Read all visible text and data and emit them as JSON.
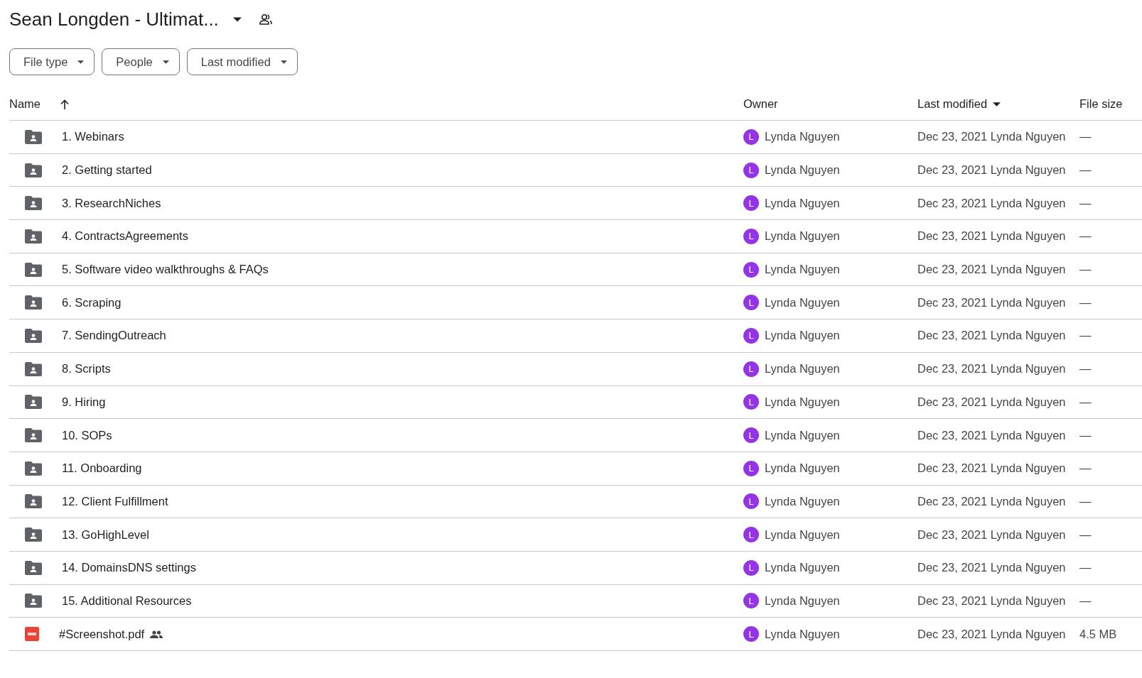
{
  "title": "Sean Longden - Ultimat...",
  "filters": [
    "File type",
    "People",
    "Last modified"
  ],
  "columns": {
    "name": "Name",
    "owner": "Owner",
    "modified": "Last modified",
    "size": "File size"
  },
  "rows": [
    {
      "kind": "folder",
      "name": "1.  Webinars",
      "shared": false,
      "avatar": "L",
      "owner": "Lynda Nguyen",
      "modified": "Dec 23, 2021 Lynda Nguyen",
      "size": "—"
    },
    {
      "kind": "folder",
      "name": "2.  Getting started",
      "shared": false,
      "avatar": "L",
      "owner": "Lynda Nguyen",
      "modified": "Dec 23, 2021 Lynda Nguyen",
      "size": "—"
    },
    {
      "kind": "folder",
      "name": "3. ResearchNiches",
      "shared": false,
      "avatar": "L",
      "owner": "Lynda Nguyen",
      "modified": "Dec 23, 2021 Lynda Nguyen",
      "size": "—"
    },
    {
      "kind": "folder",
      "name": "4. ContractsAgreements",
      "shared": false,
      "avatar": "L",
      "owner": "Lynda Nguyen",
      "modified": "Dec 23, 2021 Lynda Nguyen",
      "size": "—"
    },
    {
      "kind": "folder",
      "name": "5. Software video walkthroughs & FAQs",
      "shared": false,
      "avatar": "L",
      "owner": "Lynda Nguyen",
      "modified": "Dec 23, 2021 Lynda Nguyen",
      "size": "—"
    },
    {
      "kind": "folder",
      "name": "6. Scraping",
      "shared": false,
      "avatar": "L",
      "owner": "Lynda Nguyen",
      "modified": "Dec 23, 2021 Lynda Nguyen",
      "size": "—"
    },
    {
      "kind": "folder",
      "name": "7. SendingOutreach",
      "shared": false,
      "avatar": "L",
      "owner": "Lynda Nguyen",
      "modified": "Dec 23, 2021 Lynda Nguyen",
      "size": "—"
    },
    {
      "kind": "folder",
      "name": "8. Scripts",
      "shared": false,
      "avatar": "L",
      "owner": "Lynda Nguyen",
      "modified": "Dec 23, 2021 Lynda Nguyen",
      "size": "—"
    },
    {
      "kind": "folder",
      "name": "9. Hiring",
      "shared": false,
      "avatar": "L",
      "owner": "Lynda Nguyen",
      "modified": "Dec 23, 2021 Lynda Nguyen",
      "size": "—"
    },
    {
      "kind": "folder",
      "name": "10. SOPs",
      "shared": false,
      "avatar": "L",
      "owner": "Lynda Nguyen",
      "modified": "Dec 23, 2021 Lynda Nguyen",
      "size": "—"
    },
    {
      "kind": "folder",
      "name": "11. Onboarding",
      "shared": false,
      "avatar": "L",
      "owner": "Lynda Nguyen",
      "modified": "Dec 23, 2021 Lynda Nguyen",
      "size": "—"
    },
    {
      "kind": "folder",
      "name": "12. Client Fulfillment",
      "shared": false,
      "avatar": "L",
      "owner": "Lynda Nguyen",
      "modified": "Dec 23, 2021 Lynda Nguyen",
      "size": "—"
    },
    {
      "kind": "folder",
      "name": "13. GoHighLevel",
      "shared": false,
      "avatar": "L",
      "owner": "Lynda Nguyen",
      "modified": "Dec 23, 2021 Lynda Nguyen",
      "size": "—"
    },
    {
      "kind": "folder",
      "name": "14. DomainsDNS settings",
      "shared": false,
      "avatar": "L",
      "owner": "Lynda Nguyen",
      "modified": "Dec 23, 2021 Lynda Nguyen",
      "size": "—"
    },
    {
      "kind": "folder",
      "name": "15. Additional Resources",
      "shared": false,
      "avatar": "L",
      "owner": "Lynda Nguyen",
      "modified": "Dec 23, 2021 Lynda Nguyen",
      "size": "—"
    },
    {
      "kind": "pdf",
      "name": "#Screenshot.pdf",
      "shared": true,
      "avatar": "L",
      "owner": "Lynda Nguyen",
      "modified": "Dec 23, 2021 Lynda Nguyen",
      "size": "4.5 MB"
    }
  ]
}
